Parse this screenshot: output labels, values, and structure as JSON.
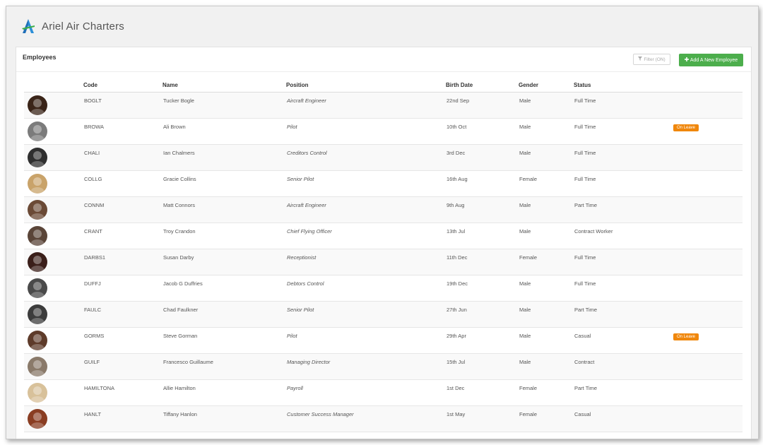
{
  "app": {
    "title": "Ariel Air Charters"
  },
  "panel": {
    "title": "Employees",
    "filter_label": "Filter (ON)",
    "add_label": "Add A New Employee"
  },
  "colors": {
    "accent_green": "#4cae4c",
    "badge_orange": "#f0870c"
  },
  "table": {
    "headers": [
      "Code",
      "Name",
      "Position",
      "Birth Date",
      "Gender",
      "Status"
    ],
    "rows": [
      {
        "code": "BOGLT",
        "name": "Tucker Bogle",
        "position": "Aircraft Engineer",
        "birth": "22nd Sep",
        "gender": "Male",
        "status": "Full Time",
        "badge": "",
        "avatar_bg": "#3a2418"
      },
      {
        "code": "BROWA",
        "name": "Ali Brown",
        "position": "Pilot",
        "birth": "10th Oct",
        "gender": "Male",
        "status": "Full Time",
        "badge": "On Leave",
        "avatar_bg": "#7b7b7b"
      },
      {
        "code": "CHALI",
        "name": "Ian Chalmers",
        "position": "Creditors Control",
        "birth": "3rd Dec",
        "gender": "Male",
        "status": "Full Time",
        "badge": "",
        "avatar_bg": "#2f2f2f"
      },
      {
        "code": "COLLG",
        "name": "Gracie Collins",
        "position": "Senior Pilot",
        "birth": "16th Aug",
        "gender": "Female",
        "status": "Full Time",
        "badge": "",
        "avatar_bg": "#c9a36a"
      },
      {
        "code": "CONNM",
        "name": "Matt Connors",
        "position": "Aircraft Engineer",
        "birth": "9th Aug",
        "gender": "Male",
        "status": "Part Time",
        "badge": "",
        "avatar_bg": "#6b4a36"
      },
      {
        "code": "CRANT",
        "name": "Troy Crandon",
        "position": "Chief Flying Officer",
        "birth": "13th Jul",
        "gender": "Male",
        "status": "Contract Worker",
        "badge": "",
        "avatar_bg": "#5a4538"
      },
      {
        "code": "DARBS1",
        "name": "Susan Darby",
        "position": "Receptionist",
        "birth": "11th Dec",
        "gender": "Female",
        "status": "Full Time",
        "badge": "",
        "avatar_bg": "#3b1f1a"
      },
      {
        "code": "DUFFJ",
        "name": "Jacob G Duffries",
        "position": "Debtors Control",
        "birth": "19th Dec",
        "gender": "Male",
        "status": "Full Time",
        "badge": "",
        "avatar_bg": "#4a4a4a"
      },
      {
        "code": "FAULC",
        "name": "Chad Faulkner",
        "position": "Senior Pilot",
        "birth": "27th Jun",
        "gender": "Male",
        "status": "Part Time",
        "badge": "",
        "avatar_bg": "#3c3c3c"
      },
      {
        "code": "GORMS",
        "name": "Steve Gorman",
        "position": "Pilot",
        "birth": "29th Apr",
        "gender": "Male",
        "status": "Casual",
        "badge": "On Leave",
        "avatar_bg": "#5e3b2a"
      },
      {
        "code": "GUILF",
        "name": "Francesco Guillaume",
        "position": "Managing Director",
        "birth": "15th Jul",
        "gender": "Male",
        "status": "Contract",
        "badge": "",
        "avatar_bg": "#8a7a6a"
      },
      {
        "code": "HAMILTONA",
        "name": "Allie Hamilton",
        "position": "Payroll",
        "birth": "1st Dec",
        "gender": "Female",
        "status": "Part Time",
        "badge": "",
        "avatar_bg": "#d8c19a"
      },
      {
        "code": "HANLT",
        "name": "Tiffany Hanlon",
        "position": "Customer Success Manager",
        "birth": "1st May",
        "gender": "Female",
        "status": "Casual",
        "badge": "",
        "avatar_bg": "#8a3d22"
      }
    ]
  }
}
